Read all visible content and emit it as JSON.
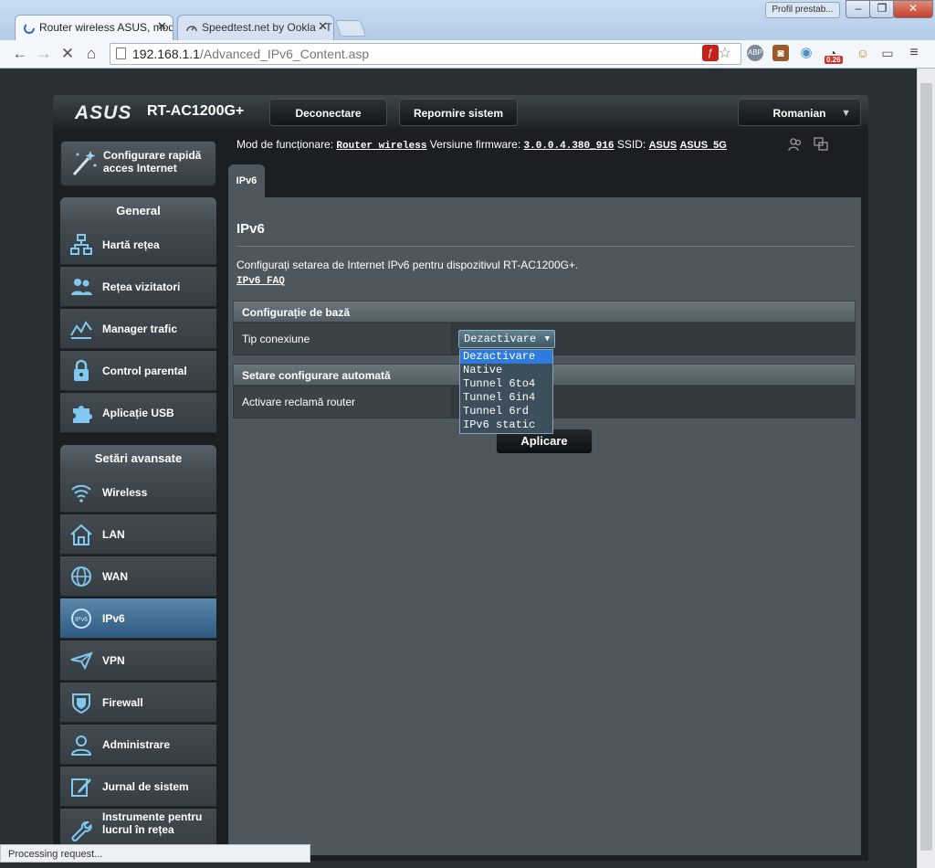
{
  "browser": {
    "tabs": [
      {
        "title": "Router wireless ASUS, mod",
        "active": true
      },
      {
        "title": "Speedtest.net by Ookla - T",
        "active": false
      }
    ],
    "profile_button": "Profil prestab...",
    "url_host": "192.168.1.1",
    "url_path": "/Advanced_IPv6_Content.asp",
    "badge_count": "0.26",
    "status_text": "Processing request..."
  },
  "router": {
    "brand": "ASUS",
    "model": "RT-AC1200G+",
    "header_buttons": {
      "logout": "Deconectare",
      "reboot": "Repornire sistem",
      "language": "Romanian"
    },
    "quick_setup": "Configurare rapidă acces Internet",
    "general_title": "General",
    "general_items": [
      {
        "label": "Hartă rețea",
        "icon": "network-map-icon"
      },
      {
        "label": "Rețea vizitatori",
        "icon": "guest-network-icon"
      },
      {
        "label": "Manager trafic",
        "icon": "traffic-manager-icon"
      },
      {
        "label": "Control parental",
        "icon": "parental-control-icon"
      },
      {
        "label": "Aplicație USB",
        "icon": "usb-app-icon"
      }
    ],
    "advanced_title": "Setări avansate",
    "advanced_items": [
      {
        "label": "Wireless",
        "icon": "wireless-icon"
      },
      {
        "label": "LAN",
        "icon": "lan-icon"
      },
      {
        "label": "WAN",
        "icon": "wan-icon"
      },
      {
        "label": "IPv6",
        "icon": "ipv6-icon",
        "selected": true
      },
      {
        "label": "VPN",
        "icon": "vpn-icon"
      },
      {
        "label": "Firewall",
        "icon": "firewall-icon"
      },
      {
        "label": "Administrare",
        "icon": "administration-icon"
      },
      {
        "label": "Jurnal de sistem",
        "icon": "system-log-icon"
      },
      {
        "label": "Instrumente pentru lucrul în rețea",
        "icon": "network-tools-icon"
      }
    ],
    "info": {
      "mode_label": "Mod de funcționare:",
      "mode_value": "Router wireless",
      "firmware_label": "Versiune firmware:",
      "firmware_value": "3.0.0.4.380_916",
      "ssid_label": "SSID:",
      "ssid_1": "ASUS",
      "ssid_2": "ASUS_5G"
    }
  },
  "content": {
    "tab": "IPv6",
    "title": "IPv6",
    "description": "Configurați setarea de Internet IPv6 pentru dispozitivul RT-AC1200G+.",
    "faq_link": "IPv6 FAQ",
    "section_basic": "Configurație de bază",
    "connection_type_label": "Tip conexiune",
    "connection_type_value": "Dezactivare",
    "dropdown_options": [
      "Dezactivare",
      "Native",
      "Tunnel 6to4",
      "Tunnel 6in4",
      "Tunnel 6rd",
      "IPv6 static"
    ],
    "section_auto": "Setare configurare automată",
    "router_advert_label": "Activare reclamă router",
    "apply_button": "Aplicare"
  },
  "colors": {
    "accent_blue": "#2e7bde",
    "selected_menu": "#4b7aa0",
    "panel": "#4d575d"
  }
}
